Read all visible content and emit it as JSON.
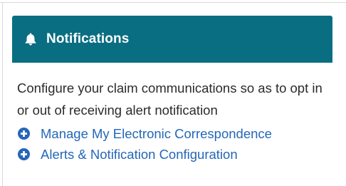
{
  "colors": {
    "header_bg": "#0a6e82",
    "header_text": "#ffffff",
    "link": "#2467b8",
    "body_text": "#2b2b2b"
  },
  "panel": {
    "header": {
      "icon": "bell-icon",
      "title": "Notifications"
    },
    "description": "Configure your claim communications so as to opt in or out of receiving alert notification",
    "links": [
      {
        "icon": "plus-circle-icon",
        "label": "Manage My Electronic Correspondence"
      },
      {
        "icon": "plus-circle-icon",
        "label": "Alerts & Notification Configuration"
      }
    ]
  }
}
